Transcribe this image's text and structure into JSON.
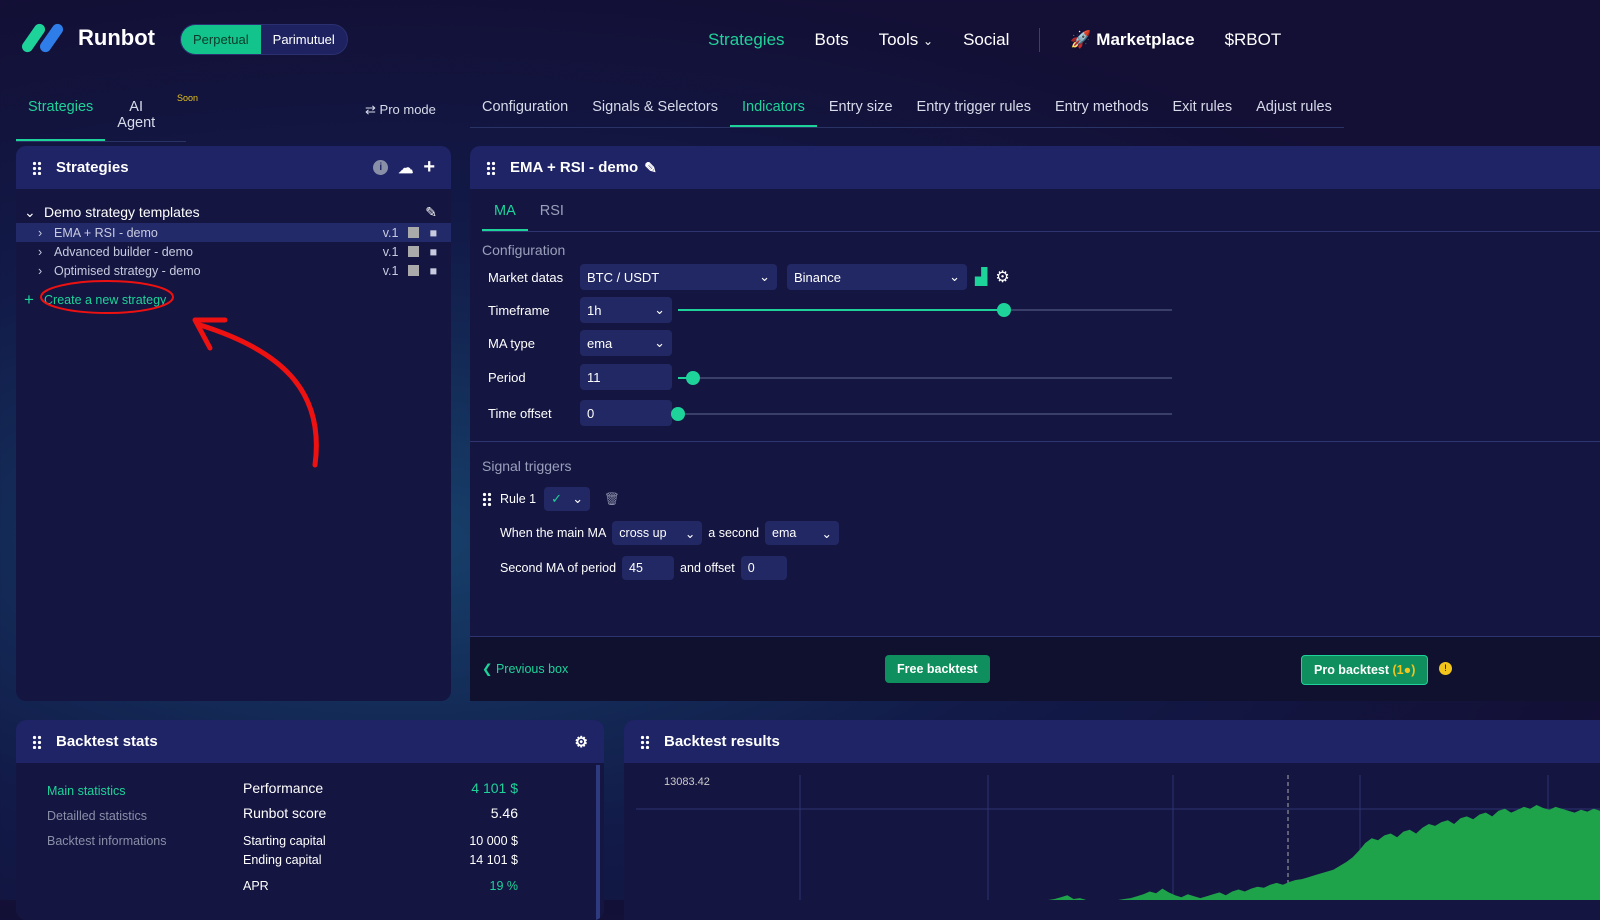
{
  "brand": {
    "name": "Runbot",
    "modes": [
      "Perpetual",
      "Parimutuel"
    ]
  },
  "nav": {
    "items": [
      "Strategies",
      "Bots",
      "Tools",
      "Social"
    ],
    "marketplace": "Marketplace",
    "token": "$RBOT"
  },
  "left_tabs": {
    "strategies": "Strategies",
    "ai_agent": "AI Agent",
    "soon": "Soon",
    "pro_mode": "Pro mode"
  },
  "main_tabs": [
    "Configuration",
    "Signals & Selectors",
    "Indicators",
    "Entry size",
    "Entry trigger rules",
    "Entry methods",
    "Exit rules",
    "Adjust rules"
  ],
  "strategies_panel": {
    "title": "Strategies",
    "group": "Demo strategy templates",
    "items": [
      {
        "name": "EMA + RSI - demo",
        "version": "v.1"
      },
      {
        "name": "Advanced builder - demo",
        "version": "v.1"
      },
      {
        "name": "Optimised strategy - demo",
        "version": "v.1"
      }
    ],
    "create": "Create a new strategy"
  },
  "editor": {
    "title": "EMA + RSI - demo",
    "tabs": [
      "MA",
      "RSI"
    ],
    "config_title": "Configuration",
    "market_label": "Market datas",
    "pair": "BTC / USDT",
    "exchange": "Binance",
    "timeframe_label": "Timeframe",
    "timeframe": "1h",
    "timeframe_slider": 0.66,
    "matype_label": "MA type",
    "matype": "ema",
    "period_label": "Period",
    "period": "11",
    "period_slider": 0.03,
    "offset_label": "Time offset",
    "offset": "0",
    "offset_slider": 0,
    "signal_title": "Signal triggers",
    "rule": "Rule 1",
    "when": "When the main MA",
    "cross": "cross up",
    "second": "a second",
    "second_type": "ema",
    "second_period_label": "Second MA of period",
    "second_period": "45",
    "and_offset": "and offset",
    "second_offset": "0",
    "prev": "Previous box",
    "free": "Free backtest",
    "pro": "Pro backtest",
    "pro_count": "(1"
  },
  "stats": {
    "title": "Backtest stats",
    "menu": [
      "Main statistics",
      "Detailled statistics",
      "Backtest informations"
    ],
    "rows": [
      {
        "k": "Performance",
        "v": "4 101 $"
      },
      {
        "k": "Runbot score",
        "v": "5.46"
      },
      {
        "k": "Starting capital",
        "v": "10 000 $"
      },
      {
        "k": "Ending capital",
        "v": "14 101 $"
      },
      {
        "k": "APR",
        "v": "19 %"
      }
    ]
  },
  "results": {
    "title": "Backtest results"
  },
  "chart_data": {
    "type": "area",
    "max_label": "13083.42",
    "values": [
      0,
      0,
      0,
      0,
      0,
      0,
      0,
      0,
      0,
      0,
      0,
      0,
      0,
      0,
      0,
      0,
      0,
      0,
      0,
      0,
      0,
      0,
      0,
      0,
      0,
      0,
      0,
      0,
      0,
      0,
      0,
      0,
      0,
      0,
      0,
      0,
      0,
      0,
      0,
      0,
      0,
      0,
      0,
      0,
      0,
      0,
      0,
      0,
      0,
      0,
      0,
      0,
      0,
      0,
      0,
      0,
      0,
      0,
      0,
      0,
      0,
      0,
      0,
      0,
      0,
      0,
      1,
      3,
      5,
      1,
      2,
      0,
      0,
      0,
      0,
      0,
      0,
      1,
      2,
      4,
      6,
      9,
      7,
      12,
      8,
      5,
      3,
      6,
      4,
      2,
      4,
      6,
      8,
      5,
      9,
      11,
      9,
      12,
      14,
      13,
      16,
      18,
      16,
      19,
      21,
      22,
      24,
      26,
      28,
      30,
      32,
      36,
      40,
      45,
      52,
      60,
      65,
      63,
      68,
      70,
      66,
      72,
      74,
      70,
      76,
      80,
      78,
      82,
      84,
      80,
      86,
      88,
      85,
      90,
      92,
      88,
      94,
      96,
      92,
      95,
      98,
      96,
      100,
      97,
      95,
      98,
      96,
      94,
      92,
      95,
      93,
      96,
      94
    ]
  }
}
